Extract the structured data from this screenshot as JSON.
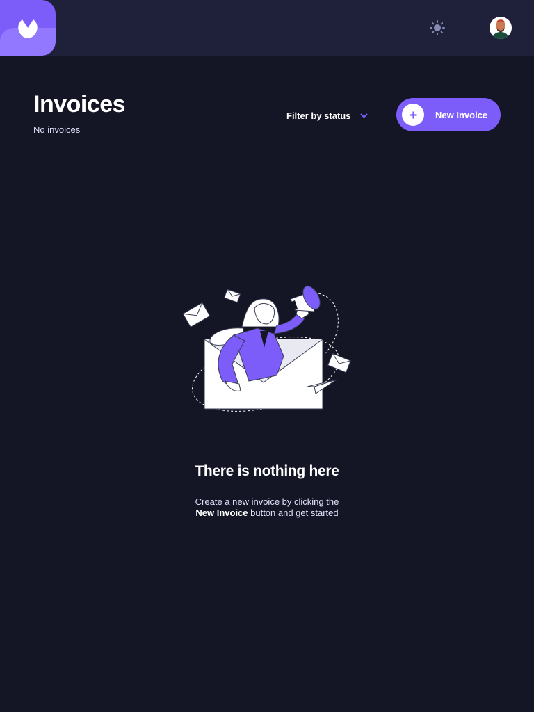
{
  "header": {
    "logo_icon": "app-logo-icon",
    "theme_icon": "sun-icon",
    "avatar_icon": "user-avatar"
  },
  "main": {
    "title": "Invoices",
    "subtitle": "No invoices",
    "filter": {
      "label": "Filter by status",
      "icon": "chevron-down-icon"
    },
    "new_button": {
      "label": "New Invoice",
      "icon": "plus-icon"
    }
  },
  "empty_state": {
    "illustration": "woman-with-megaphone-in-envelope-illustration",
    "title": "There is nothing here",
    "line1": "Create a new invoice by clicking the",
    "line2_bold": "New Invoice",
    "line2_rest": " button and get started"
  },
  "colors": {
    "background": "#141625",
    "topbar": "#1e2139",
    "accent": "#7c5dfa",
    "accent_light": "#9277ff",
    "muted_text": "#dfe3fa"
  }
}
